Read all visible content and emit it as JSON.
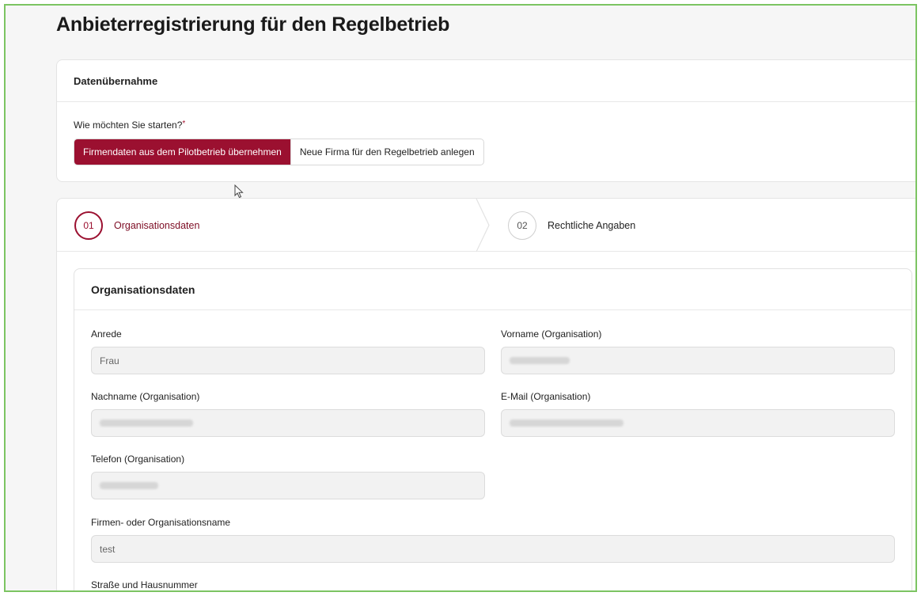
{
  "page": {
    "title": "Anbieterregistrierung für den Regelbetrieb"
  },
  "data_takeover": {
    "title": "Datenübernahme",
    "question": "Wie möchten Sie starten?",
    "required_mark": "*",
    "options": [
      {
        "label": "Firmendaten aus dem Pilotbetrieb übernehmen",
        "selected": true
      },
      {
        "label": "Neue Firma für den Regelbetrieb anlegen",
        "selected": false
      }
    ]
  },
  "stepper": {
    "steps": [
      {
        "number": "01",
        "label": "Organisationsdaten",
        "active": true
      },
      {
        "number": "02",
        "label": "Rechtliche Angaben",
        "active": false
      }
    ]
  },
  "form": {
    "title": "Organisationsdaten",
    "fields": {
      "anrede": {
        "label": "Anrede",
        "value": "Frau"
      },
      "vorname": {
        "label": "Vorname (Organisation)",
        "value": ""
      },
      "nachname": {
        "label": "Nachname (Organisation)",
        "value": ""
      },
      "email": {
        "label": "E-Mail (Organisation)",
        "value": ""
      },
      "telefon": {
        "label": "Telefon (Organisation)",
        "value": ""
      },
      "firma": {
        "label": "Firmen- oder Organisationsname",
        "value": "test"
      },
      "strasse": {
        "label": "Straße und Hausnummer"
      }
    }
  },
  "colors": {
    "accent": "#9b1030",
    "frame": "#7cc462"
  }
}
